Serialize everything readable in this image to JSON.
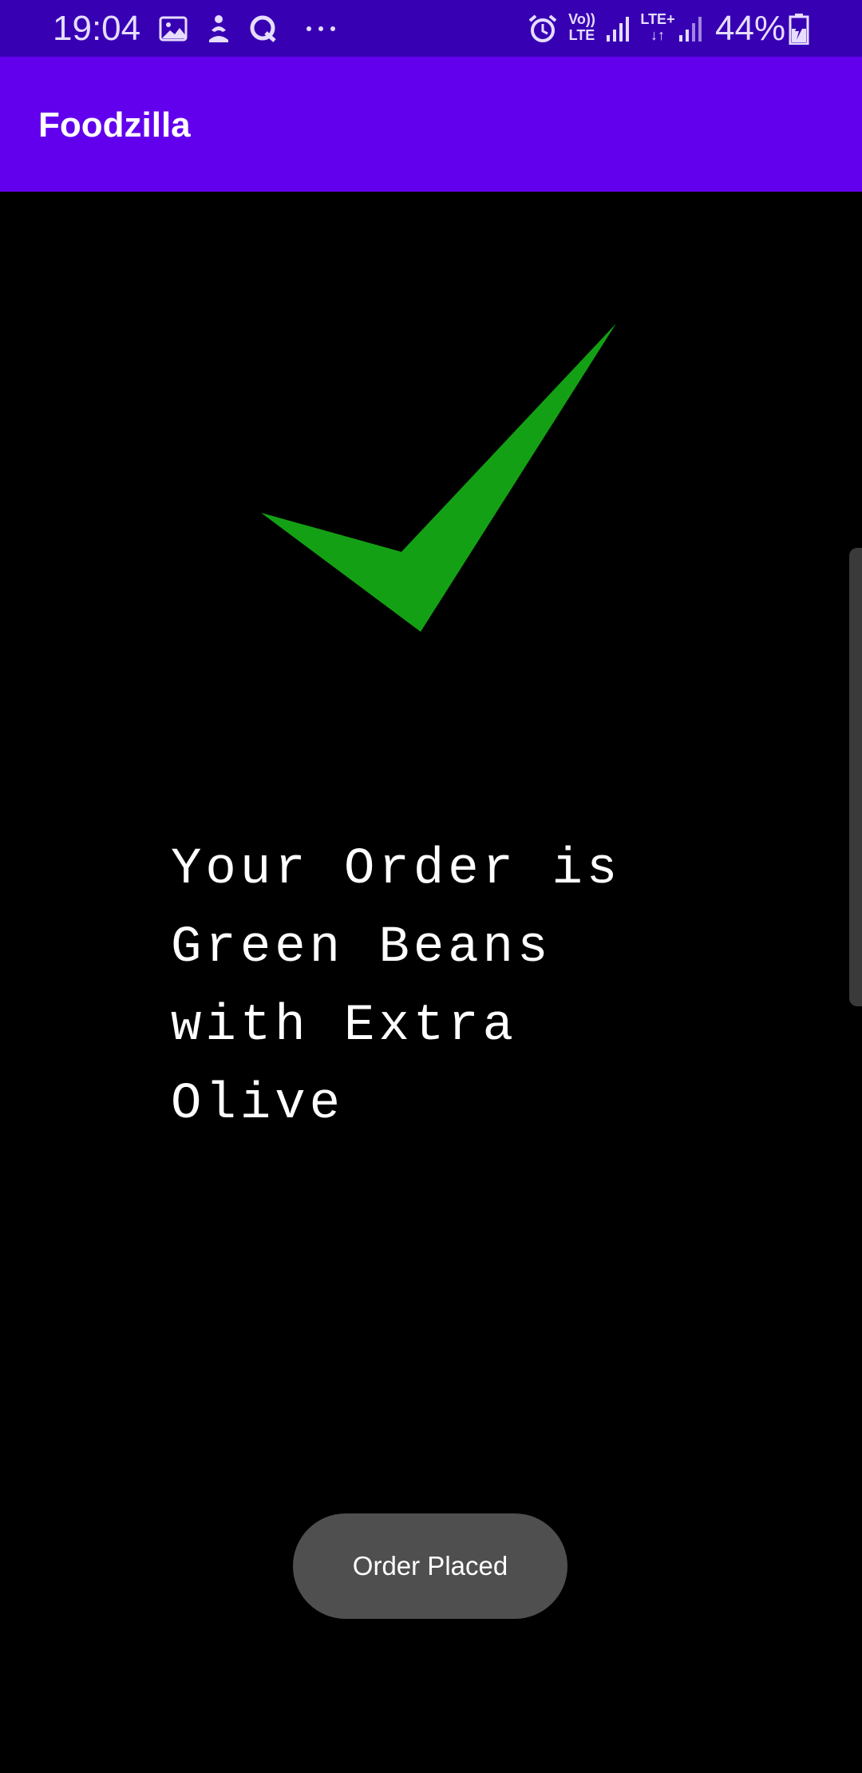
{
  "status_bar": {
    "time": "19:04",
    "battery": "44%",
    "volte_label": "Vo)) LTE",
    "lte_label": "LTE+",
    "notification_icons": [
      "gallery-icon",
      "fitness-icon",
      "q-app-icon",
      "more-dots-icon"
    ],
    "system_icons": [
      "alarm-icon",
      "volte-icon",
      "signal-icon",
      "lte-plus-icon",
      "signal-icon",
      "battery-charging-icon"
    ]
  },
  "app_bar": {
    "title": "Foodzilla"
  },
  "main": {
    "success_icon": "checkmark-icon",
    "check_color": "#14A014",
    "order_line_1": "Your Order is",
    "order_line_2": "Green Beans",
    "order_line_3": "with Extra",
    "order_line_4": "Olive"
  },
  "toast": {
    "message": "Order Placed"
  },
  "colors": {
    "status_bar": "#3700B3",
    "app_bar": "#6200EE",
    "background": "#000000",
    "toast": "#4F4F4F"
  }
}
